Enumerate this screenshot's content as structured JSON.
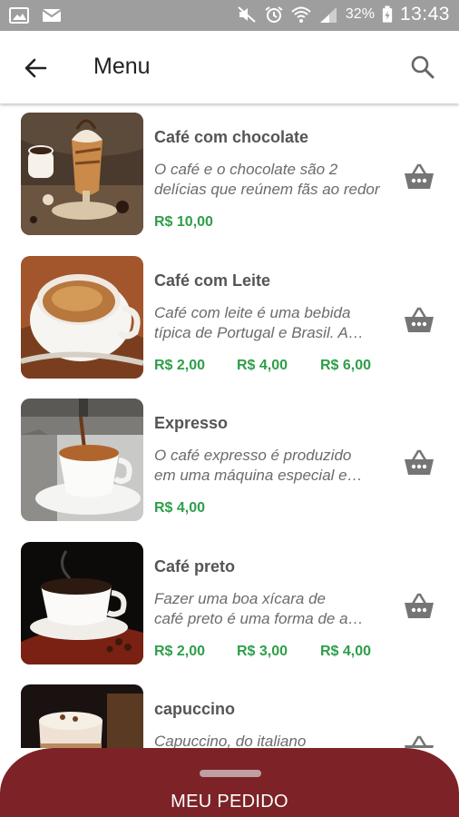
{
  "status_bar": {
    "battery": "32%",
    "time": "13:43"
  },
  "app_bar": {
    "title": "Menu"
  },
  "items": [
    {
      "name": "Café com chocolate",
      "desc_line1": "O café e o chocolate são 2",
      "desc_line2": "delícias que reúnem fãs ao redor",
      "prices": [
        "R$ 10,00"
      ]
    },
    {
      "name": "Café com Leite",
      "desc_line1": "Café com leite é uma bebida",
      "desc_line2": "típica de Portugal e Brasil. A…",
      "prices": [
        "R$ 2,00",
        "R$ 4,00",
        "R$ 6,00"
      ]
    },
    {
      "name": "Expresso",
      "desc_line1": "O café expresso é produzido",
      "desc_line2": "em uma máquina especial e…",
      "prices": [
        "R$ 4,00"
      ]
    },
    {
      "name": "Café preto",
      "desc_line1": "Fazer uma boa xícara de",
      "desc_line2": "café preto é uma forma de a…",
      "prices": [
        "R$ 2,00",
        "R$ 3,00",
        "R$ 4,00"
      ]
    },
    {
      "name": "capuccino",
      "desc_line1": "Capuccino, do italiano",
      "desc_line2": "",
      "prices": []
    }
  ],
  "bottom_sheet": {
    "label": "MEU PEDIDO"
  },
  "colors": {
    "accent": "#7d2327",
    "price": "#2e9e49",
    "status_bar": "#9e9e9e"
  }
}
